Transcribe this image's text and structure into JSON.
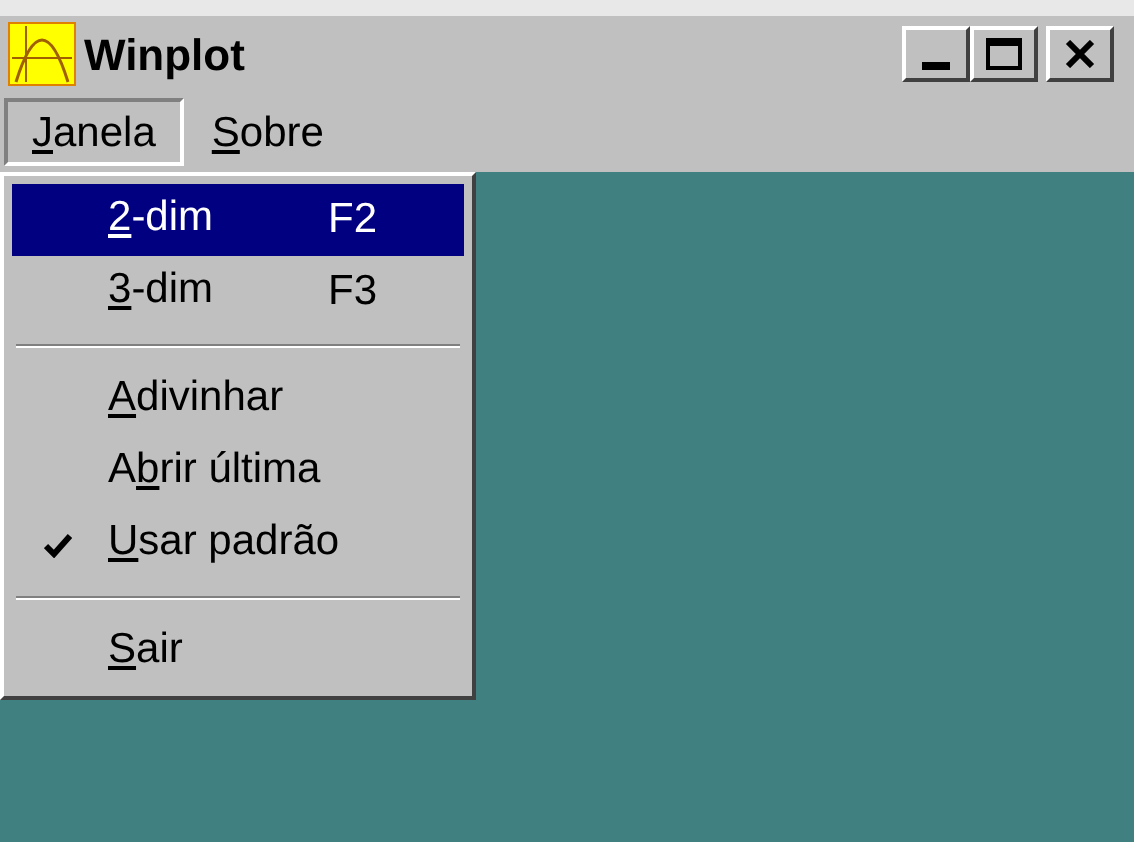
{
  "window": {
    "title": "Winplot"
  },
  "menu_bar": [
    {
      "access_key": "J",
      "after": "anela",
      "selected": true
    },
    {
      "access_key": "S",
      "after": "obre",
      "selected": false
    }
  ],
  "menu": [
    {
      "kind": "item",
      "access_key": "2",
      "after": "-dim",
      "shortcut": "F2",
      "selected": true,
      "checked": false
    },
    {
      "kind": "item",
      "access_key": "3",
      "after": "-dim",
      "shortcut": "F3",
      "selected": false,
      "checked": false
    },
    {
      "kind": "separator"
    },
    {
      "kind": "item",
      "access_key": "A",
      "after": "divinhar",
      "selected": false,
      "checked": false
    },
    {
      "kind": "item",
      "before": "A",
      "access_key": "b",
      "after": "rir última",
      "selected": false,
      "checked": false
    },
    {
      "kind": "item",
      "access_key": "U",
      "after": "sar padrão",
      "selected": false,
      "checked": true
    },
    {
      "kind": "separator"
    },
    {
      "kind": "item",
      "access_key": "S",
      "after": "air",
      "selected": false,
      "checked": false
    }
  ]
}
